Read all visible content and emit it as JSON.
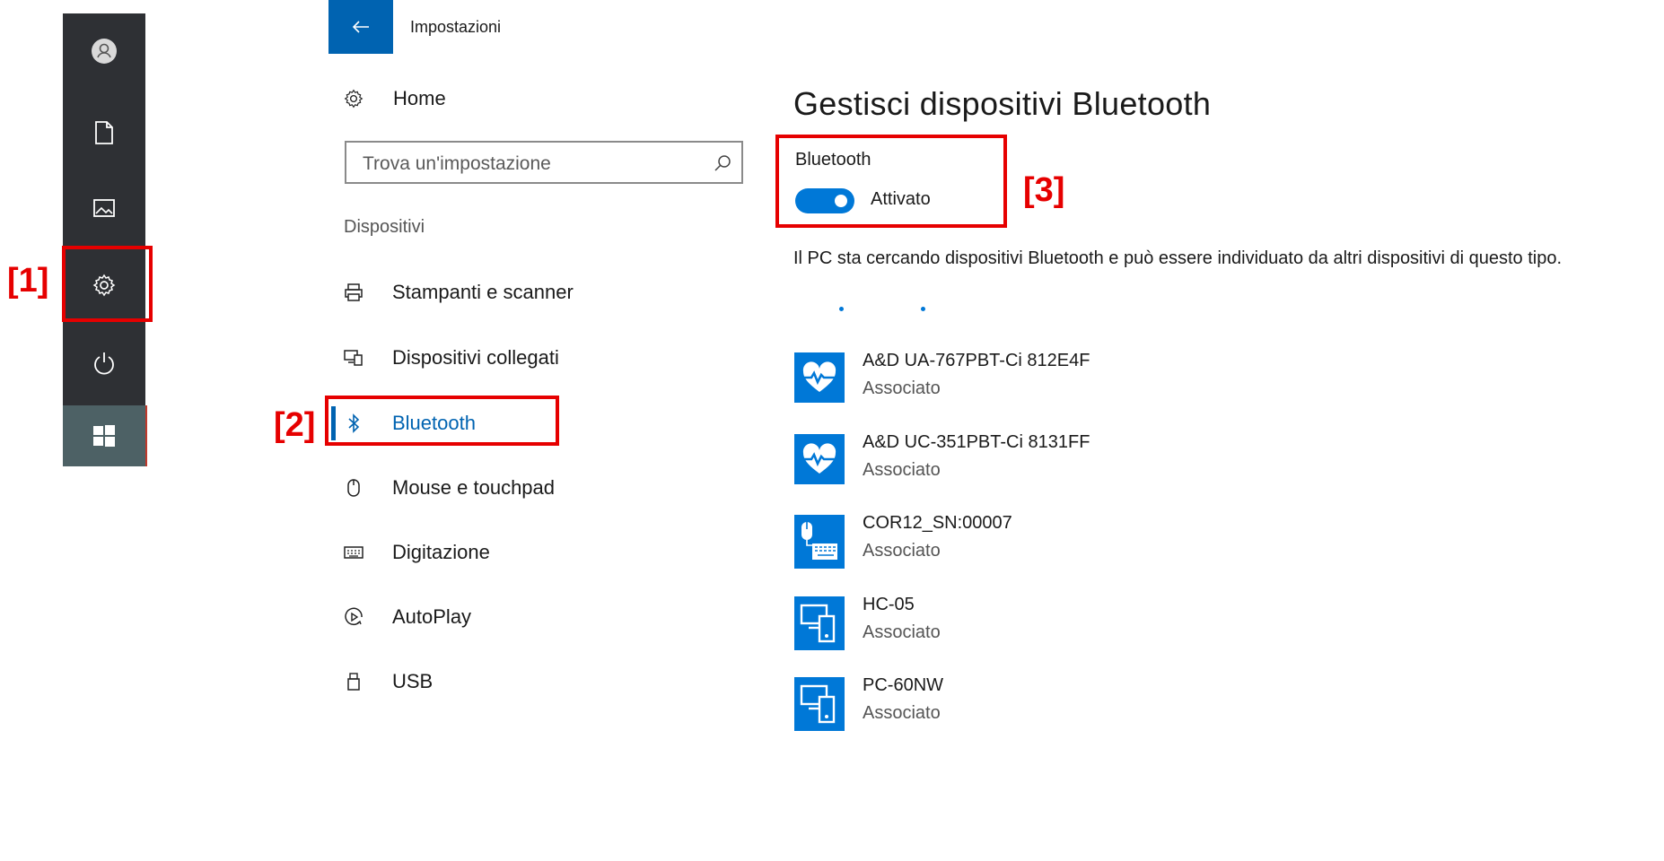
{
  "start_strip": {
    "icons": [
      "account-icon",
      "document-icon",
      "pictures-icon",
      "settings-icon",
      "power-icon"
    ],
    "windows_icon": "windows-logo-icon"
  },
  "callouts": {
    "one": "[1]",
    "two": "[2]",
    "three": "[3]"
  },
  "header": {
    "back_icon": "back-arrow-icon",
    "title": "Impostazioni"
  },
  "nav": {
    "home_label": "Home",
    "search_placeholder": "Trova un'impostazione",
    "section": "Dispositivi",
    "items": [
      {
        "label": "Stampanti e scanner",
        "icon": "printer-icon"
      },
      {
        "label": "Dispositivi collegati",
        "icon": "connected-devices-icon"
      },
      {
        "label": "Bluetooth",
        "icon": "bluetooth-icon",
        "selected": true
      },
      {
        "label": "Mouse e touchpad",
        "icon": "mouse-icon"
      },
      {
        "label": "Digitazione",
        "icon": "keyboard-icon"
      },
      {
        "label": "AutoPlay",
        "icon": "autoplay-icon"
      },
      {
        "label": "USB",
        "icon": "usb-icon"
      }
    ]
  },
  "main": {
    "title": "Gestisci dispositivi Bluetooth",
    "bluetooth_label": "Bluetooth",
    "toggle_on": true,
    "toggle_state": "Attivato",
    "description": "Il PC sta cercando dispositivi Bluetooth e può essere individuato da altri dispositivi di questo tipo.",
    "devices": [
      {
        "name": "A&D UA-767PBT-Ci 812E4F",
        "status": "Associato",
        "icon": "heart-monitor-icon"
      },
      {
        "name": "A&D UC-351PBT-Ci 8131FF",
        "status": "Associato",
        "icon": "heart-monitor-icon"
      },
      {
        "name": "COR12_SN:00007",
        "status": "Associato",
        "icon": "mouse-keyboard-icon"
      },
      {
        "name": "HC-05",
        "status": "Associato",
        "icon": "computer-phone-icon"
      },
      {
        "name": "PC-60NW",
        "status": "Associato",
        "icon": "computer-phone-icon"
      }
    ]
  },
  "colors": {
    "accent": "#0078d7",
    "back_button": "#0063b1",
    "strip_bg": "#2e3034",
    "callout": "#e60000"
  }
}
